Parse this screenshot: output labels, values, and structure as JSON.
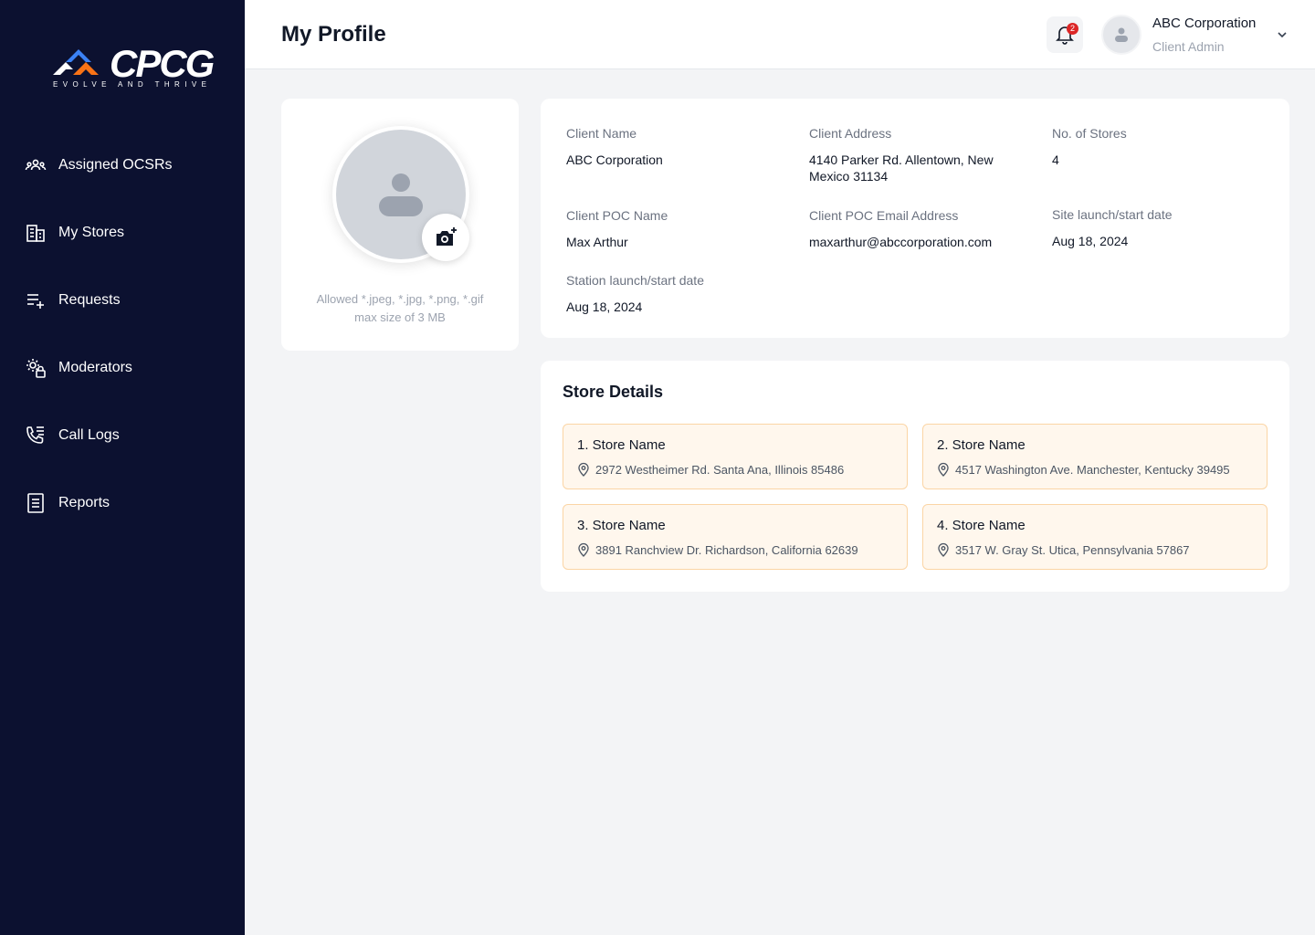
{
  "brand": {
    "logo_text": "CPCG",
    "tagline": "EVOLVE AND THRIVE",
    "colors": {
      "sidebar_bg": "#0c1130",
      "accent_orange": "#f97316",
      "accent_blue": "#3b82f6"
    }
  },
  "sidebar": {
    "items": [
      {
        "label": "Assigned OCSRs",
        "icon": "users-icon"
      },
      {
        "label": "My Stores",
        "icon": "building-icon"
      },
      {
        "label": "Requests",
        "icon": "list-add-icon"
      },
      {
        "label": "Moderators",
        "icon": "moderator-settings-icon"
      },
      {
        "label": "Call Logs",
        "icon": "phone-list-icon"
      },
      {
        "label": "Reports",
        "icon": "report-document-icon"
      }
    ]
  },
  "header": {
    "title": "My Profile",
    "notification_count": "2",
    "user_name": "ABC Corporation",
    "user_role": "Client Admin"
  },
  "photo": {
    "hint_line1": "Allowed *.jpeg, *.jpg, *.png, *.gif",
    "hint_line2": "max size of 3 MB"
  },
  "info": {
    "client_name_label": "Client Name",
    "client_name": "ABC Corporation",
    "client_address_label": "Client Address",
    "client_address": "4140 Parker Rd. Allentown, New Mexico 31134",
    "stores_count_label": "No. of Stores",
    "stores_count": "4",
    "poc_name_label": "Client POC Name",
    "poc_name": "Max Arthur",
    "poc_email_label": "Client POC Email Address",
    "poc_email": "maxarthur@abccorporation.com",
    "site_launch_label": "Site launch/start date",
    "site_launch": "Aug 18, 2024",
    "station_launch_label": "Station launch/start date",
    "station_launch": "Aug 18, 2024"
  },
  "stores": {
    "title": "Store Details",
    "items": [
      {
        "name": "1. Store Name",
        "address": "2972 Westheimer Rd. Santa Ana, Illinois 85486"
      },
      {
        "name": "2. Store Name",
        "address": "4517 Washington Ave. Manchester, Kentucky 39495"
      },
      {
        "name": "3. Store Name",
        "address": "3891 Ranchview Dr. Richardson, California 62639"
      },
      {
        "name": "4. Store Name",
        "address": "3517 W. Gray St. Utica, Pennsylvania 57867"
      }
    ]
  }
}
